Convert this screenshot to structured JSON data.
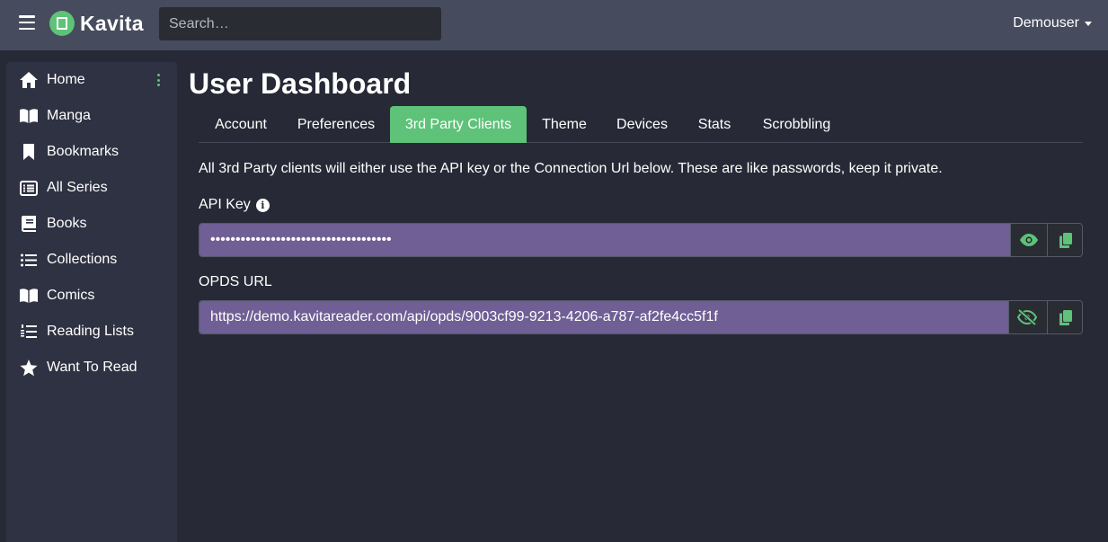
{
  "header": {
    "brand": "Kavita",
    "search_placeholder": "Search…",
    "user": "Demouser"
  },
  "sidebar": {
    "items": [
      {
        "label": "Home",
        "icon": "home-icon"
      },
      {
        "label": "Manga",
        "icon": "book-open-icon"
      },
      {
        "label": "Bookmarks",
        "icon": "bookmark-icon"
      },
      {
        "label": "All Series",
        "icon": "list-alt-icon"
      },
      {
        "label": "Books",
        "icon": "book-icon"
      },
      {
        "label": "Collections",
        "icon": "list-icon"
      },
      {
        "label": "Comics",
        "icon": "book-open-icon"
      },
      {
        "label": "Reading Lists",
        "icon": "list-ol-icon"
      },
      {
        "label": "Want To Read",
        "icon": "star-icon"
      }
    ]
  },
  "main": {
    "title": "User Dashboard",
    "tabs": [
      {
        "label": "Account"
      },
      {
        "label": "Preferences"
      },
      {
        "label": "3rd Party Clients",
        "active": true
      },
      {
        "label": "Theme"
      },
      {
        "label": "Devices"
      },
      {
        "label": "Stats"
      },
      {
        "label": "Scrobbling"
      }
    ],
    "description": "All 3rd Party clients will either use the API key or the Connection Url below. These are like passwords, keep it private.",
    "api_key": {
      "label": "API Key",
      "value": "••••••••••••••••••••••••••••••••••••"
    },
    "opds": {
      "label": "OPDS URL",
      "value": "https://demo.kavitareader.com/api/opds/9003cf99-9213-4206-a787-af2fe4cc5f1f"
    }
  },
  "colors": {
    "accent": "#5ec279",
    "topbar": "#464b5d",
    "background": "#272a36",
    "sidebar": "#2f3242",
    "input_fill": "#6f5f95"
  }
}
